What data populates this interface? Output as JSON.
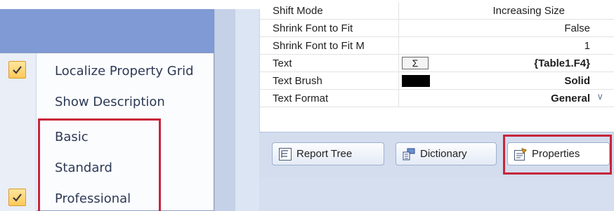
{
  "property_grid": {
    "rows": [
      {
        "name": "Shift Mode",
        "value": "Increasing Size",
        "bold": false
      },
      {
        "name": "Shrink Font to Fit",
        "value": "False",
        "bold": false
      },
      {
        "name": "Shrink Font to Fit M",
        "value": "1",
        "bold": false
      },
      {
        "name": "Text",
        "value": "{Table1.F4}",
        "bold": true,
        "icon": "sigma-button",
        "icon_text": "Σ"
      },
      {
        "name": "Text Brush",
        "value": "Solid",
        "bold": true,
        "swatch_color": "#000000"
      },
      {
        "name": "Text Format",
        "value": "General",
        "bold": true,
        "chevron": "∨"
      }
    ]
  },
  "tabs": [
    {
      "label": "Report Tree",
      "icon": "report-tree-icon"
    },
    {
      "label": "Dictionary",
      "icon": "dictionary-icon"
    },
    {
      "label": "Properties",
      "icon": "properties-icon",
      "active": true
    }
  ],
  "context_menu": {
    "items": [
      {
        "label": "Localize Property Grid",
        "checked": true
      },
      {
        "label": "Show Description",
        "checked": false
      },
      {
        "label": "Basic",
        "checked": false
      },
      {
        "label": "Standard",
        "checked": false
      },
      {
        "label": "Professional",
        "checked": true
      }
    ]
  },
  "colors": {
    "highlight": "#c8253a",
    "check_bg": "#ffc95a",
    "left_panel": "#7f9ad4",
    "background": "#d6dff0"
  }
}
